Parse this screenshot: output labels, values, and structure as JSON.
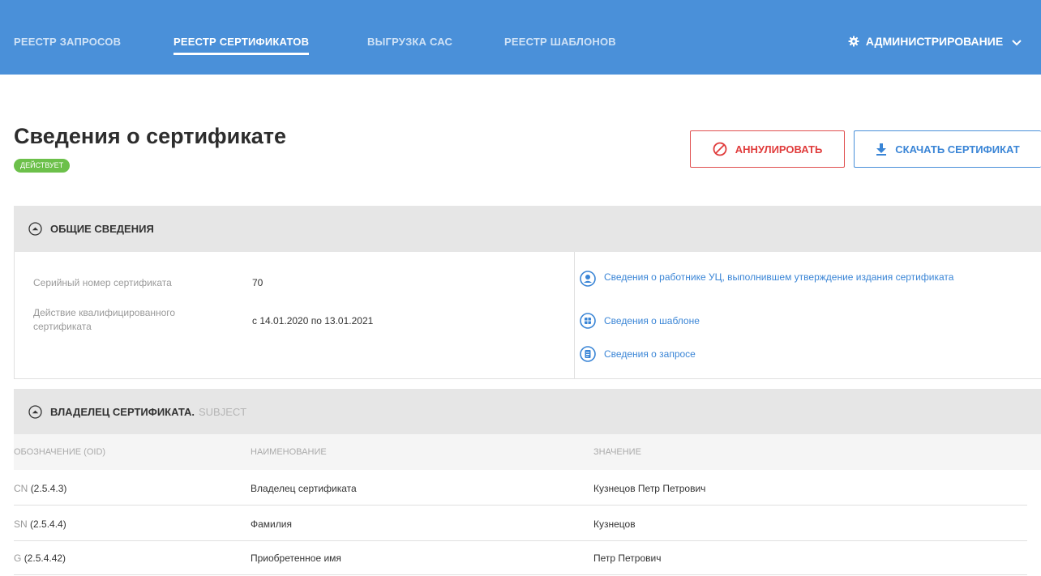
{
  "nav": {
    "items": [
      {
        "label": "РЕЕСТР ЗАПРОСОВ"
      },
      {
        "label": "РЕЕСТР СЕРТИФИКАТОВ",
        "active": true
      },
      {
        "label": "ВЫГРУЗКА САС"
      },
      {
        "label": "РЕЕСТР ШАБЛОНОВ"
      }
    ],
    "admin_label": "АДМИНИСТРИРОВАНИЕ"
  },
  "page": {
    "title": "Сведения о сертификате",
    "status": "ДЕЙСТВУЕТ"
  },
  "actions": {
    "revoke_label": "АННУЛИРОВАТЬ",
    "download_label": "СКАЧАТЬ СЕРТИФИКАТ"
  },
  "general": {
    "title": "ОБЩИЕ СВЕДЕНИЯ",
    "fields": [
      {
        "label": "Серийный номер сертификата",
        "value": "70"
      },
      {
        "label": "Действие квалифицированного сертификата",
        "value": "с 14.01.2020 по 13.01.2021"
      }
    ],
    "links": [
      {
        "label": "Сведения о работнике УЦ, выполнившем утверждение издания сертификата",
        "icon": "user-circle-icon"
      },
      {
        "label": "Сведения о шаблоне",
        "icon": "template-icon"
      },
      {
        "label": "Сведения о запросе",
        "icon": "document-icon"
      }
    ]
  },
  "owner": {
    "title": "ВЛАДЕЛЕЦ СЕРТИФИКАТА.",
    "subtitle": "SUBJECT",
    "columns": [
      "ОБОЗНАЧЕНИЕ (OID)",
      "НАИМЕНОВАНИЕ",
      "ЗНАЧЕНИЕ"
    ],
    "rows": [
      {
        "code": "CN",
        "oid": "(2.5.4.3)",
        "name": "Владелец сертификата",
        "value": "Кузнецов Петр Петрович"
      },
      {
        "code": "SN",
        "oid": "(2.5.4.4)",
        "name": "Фамилия",
        "value": "Кузнецов"
      },
      {
        "code": "G",
        "oid": "(2.5.4.42)",
        "name": "Приобретенное имя",
        "value": "Петр Петрович"
      }
    ]
  },
  "colors": {
    "header": "#4a90d9",
    "active_badge": "#6cc04a",
    "danger": "#e03c3c",
    "link": "#3a85d6"
  }
}
